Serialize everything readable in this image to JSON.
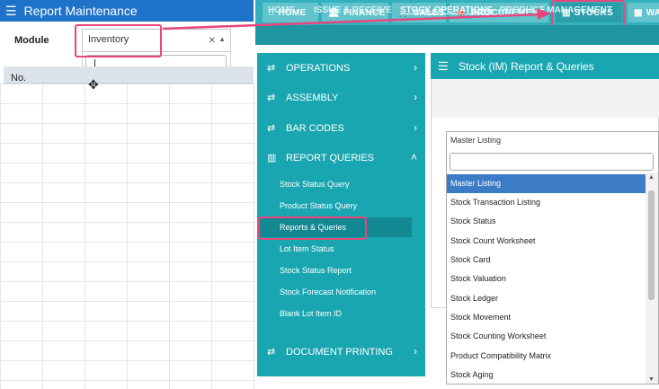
{
  "report_maintenance": {
    "title": "Report Maintenance",
    "module_label": "Module",
    "module_value": "Inventory",
    "table_header": "No."
  },
  "top_nav": {
    "tabs": [
      {
        "label": "HOME",
        "icon": "home-icon"
      },
      {
        "label": "FINANCE",
        "icon": "bank-icon"
      },
      {
        "label": "SALES",
        "icon": "cart-icon"
      },
      {
        "label": "PROCUREMENT",
        "icon": "megaphone-icon"
      },
      {
        "label": "STOCKS",
        "icon": "bar-chart-icon"
      },
      {
        "label": "WA",
        "icon": "warehouse-icon"
      }
    ],
    "sub_items": [
      "HOME",
      "ISSUE & RECEIVE",
      "STOCK OPERATIONS",
      "PRODUCT MANAGEMENT"
    ]
  },
  "sidebar": {
    "menus": [
      {
        "label": "OPERATIONS"
      },
      {
        "label": "ASSEMBLY"
      },
      {
        "label": "BAR CODES"
      },
      {
        "label": "REPORT QUERIES"
      }
    ],
    "report_queries_items": [
      "Stock Status Query",
      "Product Status Query",
      "Reports & Queries",
      "Lot Item Status",
      "Stock Status Report",
      "Stock Forecast Notification",
      "Blank Lot Item ID"
    ],
    "document_printing": "DOCUMENT PRINTING"
  },
  "main": {
    "title": "Stock (IM) Report & Queries",
    "select_value": "Master Listing",
    "options": [
      "Master Listing",
      "Stock Transaction Listing",
      "Stock Status",
      "Stock Count Worksheet",
      "Stock Card",
      "Stock Valuation",
      "Stock Ledger",
      "Stock Movement",
      "Stock Counting Worksheet",
      "Product Compatibility Matrix",
      "Stock Aging"
    ]
  },
  "colors": {
    "accent_teal": "#1aa6b1",
    "highlight_pink": "#e8467c",
    "title_blue": "#1e73c8",
    "selected_option": "#3c7cc6"
  }
}
